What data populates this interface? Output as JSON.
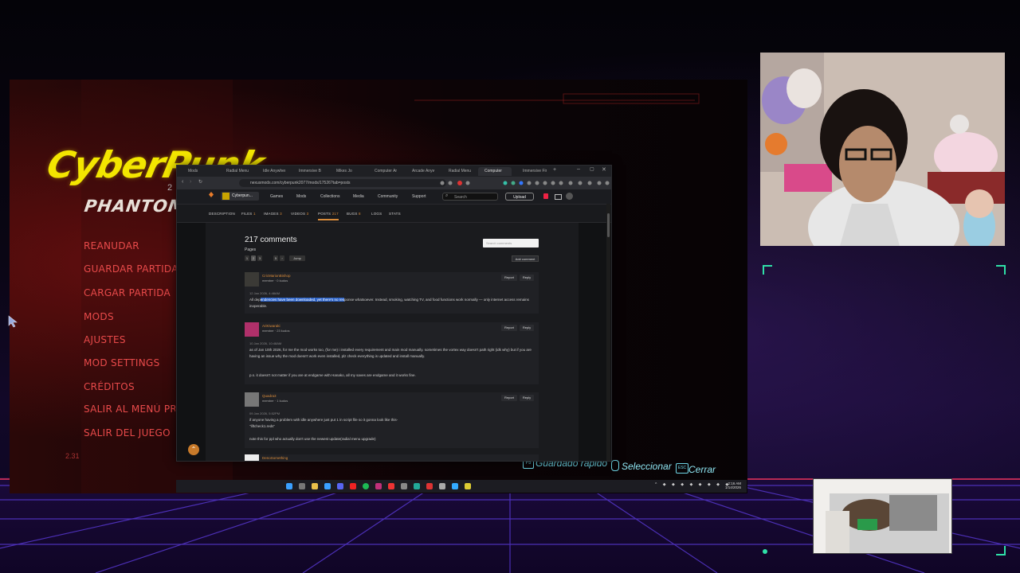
{
  "game": {
    "logo_main": "CyberPunk",
    "logo_sub": "PHANTOM LIBERTY",
    "version_number": "2",
    "menu": [
      "REANUDAR",
      "GUARDAR PARTIDA",
      "CARGAR PARTIDA",
      "MODS",
      "AJUSTES",
      "MOD SETTINGS",
      "CRÉDITOS",
      "SALIR AL MENÚ PRINCIPAL",
      "SALIR DEL JUEGO"
    ],
    "version": "2.31",
    "hints": {
      "quicksave_key": "F5",
      "quicksave": "Guardado rápido",
      "select": "Seleccionar",
      "close_key": "ESC",
      "close": "Cerrar"
    }
  },
  "browser": {
    "tabs": [
      "Mods",
      "Radial Menu U",
      "Idle Anywher",
      "Immersive Bar",
      "Mikes Jo",
      "Computer Any",
      "Arcade Anywh",
      "Radial Menu U",
      "Computer",
      "Immersive Fir"
    ],
    "url": "nexusmods.com/cyberpunk2077/mods/17526?tab=posts",
    "site": {
      "game_label": "Cyberpun...",
      "nav": [
        "Games",
        "Mods",
        "Collections",
        "Media",
        "Community",
        "Support"
      ],
      "search_placeholder": "Search",
      "upload": "Upload"
    },
    "mod_tabs": [
      {
        "label": "DESCRIPTION",
        "count": ""
      },
      {
        "label": "FILES",
        "count": "1"
      },
      {
        "label": "IMAGES",
        "count": "3"
      },
      {
        "label": "VIDEOS",
        "count": "3"
      },
      {
        "label": "POSTS",
        "count": "217"
      },
      {
        "label": "BUGS",
        "count": "8"
      },
      {
        "label": "LOGS",
        "count": ""
      },
      {
        "label": "STATS",
        "count": ""
      }
    ],
    "comments_title": "217 comments",
    "pages_label": "Pages",
    "pages": [
      "1",
      "2",
      "3",
      "",
      "5",
      "Jump"
    ],
    "search_comments_placeholder": "Search comments",
    "add_comment": "Add comment",
    "comments": [
      {
        "user": "CricMarionBishop",
        "role": "member",
        "kudos": "0 kudos",
        "date": "12 Jan 2026, 4:48AM",
        "text_pre": "All dep",
        "text_hl": "endencies have been downloaded, yet there's no res",
        "text_post": "ponse whatsoever. Instead, smoking, watching TV, and food functions work normally — only internet access remains inoperable.",
        "report": "Report",
        "reply": "Reply",
        "avatar_color": "#3b3a36"
      },
      {
        "user": "AriKiwaraki",
        "role": "member",
        "kudos": "23 kudos",
        "date": "10 Jan 2026, 10:48AM",
        "text": "as of Jan 10th 2026, for me the mod works too, (for me) i installed every requirement and main mod manually. sometimes the vortex way doesn't path right (idk why) but if you are having an issue why the mod doesn't work even installed, plz check everything is updated and install manually.",
        "text2": "p.s. it doesn't not matter if you are at endgame with Hanako, all my saves are endgame and it works fine.",
        "report": "Report",
        "reply": "Reply",
        "avatar_color": "#b0306a"
      },
      {
        "user": "Quadra3",
        "role": "member",
        "kudos": "1 kudos",
        "date": "09 Jan 2026, 5:52PM",
        "text": "if anyone having a problem with idle anywhere just put 1 in script file so it gonna look like this-",
        "text2": "\"liftcheck1.reds\"",
        "text3": "note this for ppl who actually don't use the newest update(radial menu upgrade)",
        "report": "Report",
        "reply": "Reply",
        "avatar_color": "#777"
      },
      {
        "user": "DenoSomething",
        "avatar_color": "#eee"
      }
    ]
  },
  "taskbar": {
    "time": "2:16 AM",
    "date": "1/14/2026"
  }
}
